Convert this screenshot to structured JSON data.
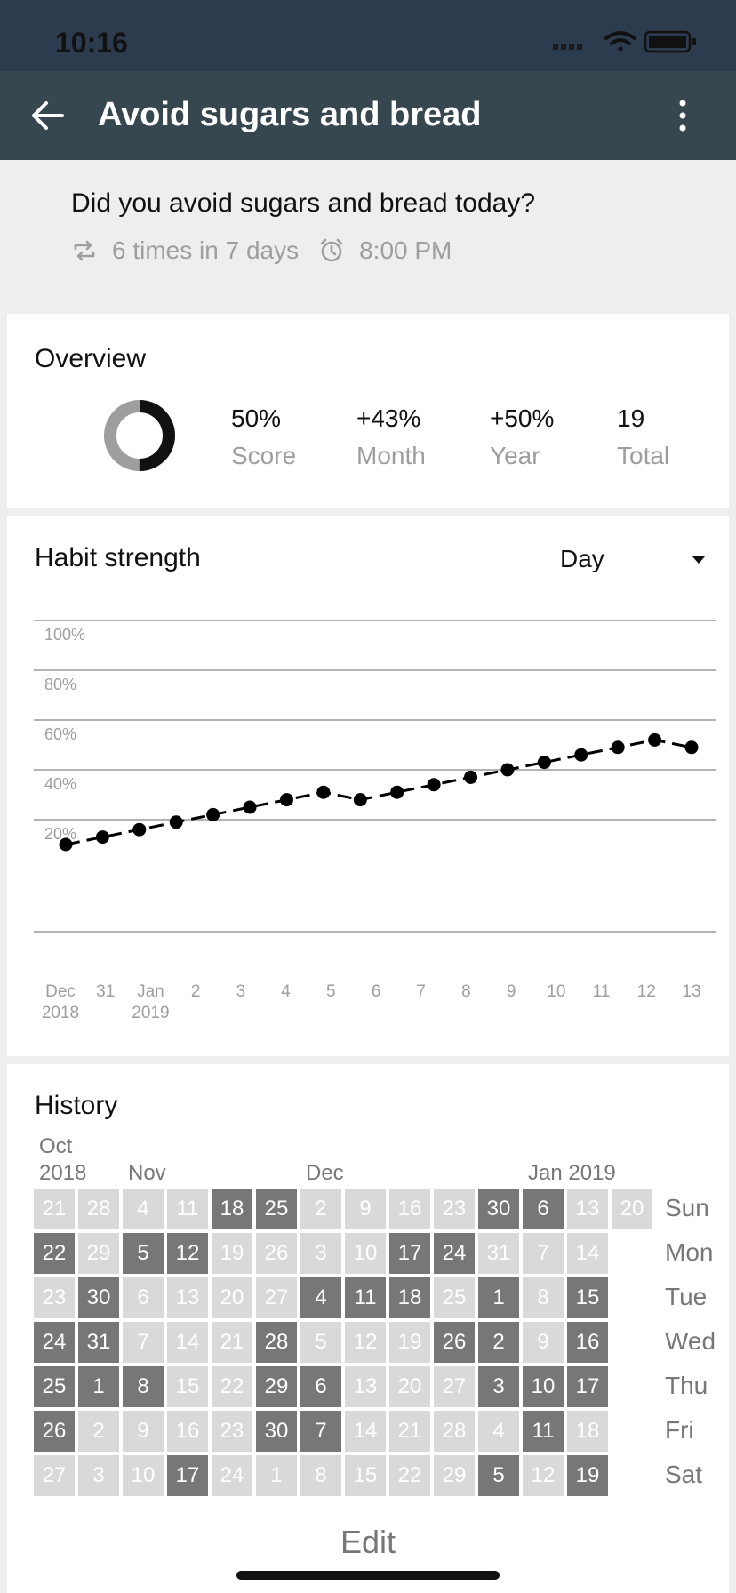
{
  "status_bar": {
    "time": "10:16"
  },
  "app_bar": {
    "title": "Avoid sugars and bread"
  },
  "header": {
    "question": "Did you avoid sugars and bread today?",
    "frequency": "6 times in 7 days",
    "reminder": "8:00 PM"
  },
  "overview": {
    "title": "Overview",
    "score_fraction": 0.5,
    "stats": [
      {
        "value": "50%",
        "label": "Score"
      },
      {
        "value": "+43%",
        "label": "Month"
      },
      {
        "value": "+50%",
        "label": "Year"
      },
      {
        "value": "19",
        "label": "Total"
      }
    ]
  },
  "strength": {
    "title": "Habit strength",
    "period": "Day",
    "chart_data": {
      "type": "line",
      "x": [
        "Dec 2018",
        "31",
        "Jan 2019",
        "2",
        "3",
        "4",
        "5",
        "6",
        "7",
        "8",
        "9",
        "10",
        "11",
        "12",
        "13"
      ],
      "x_ticks": [
        "Dec",
        "31",
        "Jan",
        "2",
        "3",
        "4",
        "5",
        "6",
        "7",
        "8",
        "9",
        "10",
        "11",
        "12",
        "13"
      ],
      "x_ticks_secondary": [
        "2018",
        "",
        "2019",
        "",
        "",
        "",
        "",
        "",
        "",
        "",
        "",
        "",
        "",
        "",
        ""
      ],
      "y_ticks": [
        "100%",
        "80%",
        "60%",
        "40%",
        "20%"
      ],
      "ylim": [
        0,
        100
      ],
      "grid": true,
      "series": [
        {
          "values": [
            10,
            13,
            16,
            19,
            22,
            25,
            28,
            31,
            28,
            31,
            34,
            37,
            40,
            43,
            46,
            49,
            52,
            49
          ]
        }
      ]
    }
  },
  "history": {
    "title": "History",
    "months": [
      {
        "line1": "Oct",
        "line2": "2018",
        "col": 0
      },
      {
        "line1": "",
        "line2": "Nov",
        "col": 2
      },
      {
        "line1": "",
        "line2": "Dec",
        "col": 6
      },
      {
        "line1": "",
        "line2": "Jan 2019",
        "col": 11
      }
    ],
    "weekdays": [
      "Sun",
      "Mon",
      "Tue",
      "Wed",
      "Thu",
      "Fri",
      "Sat"
    ],
    "weeks": [
      [
        [
          "21",
          0
        ],
        [
          "22",
          1
        ],
        [
          "23",
          0
        ],
        [
          "24",
          1
        ],
        [
          "25",
          1
        ],
        [
          "26",
          1
        ],
        [
          "27",
          0
        ]
      ],
      [
        [
          "28",
          0
        ],
        [
          "29",
          0
        ],
        [
          "30",
          1
        ],
        [
          "31",
          1
        ],
        [
          "1",
          1
        ],
        [
          "2",
          0
        ],
        [
          "3",
          0
        ]
      ],
      [
        [
          "4",
          0
        ],
        [
          "5",
          1
        ],
        [
          "6",
          0
        ],
        [
          "7",
          0
        ],
        [
          "8",
          1
        ],
        [
          "9",
          0
        ],
        [
          "10",
          0
        ]
      ],
      [
        [
          "11",
          0
        ],
        [
          "12",
          1
        ],
        [
          "13",
          0
        ],
        [
          "14",
          0
        ],
        [
          "15",
          0
        ],
        [
          "16",
          0
        ],
        [
          "17",
          1
        ]
      ],
      [
        [
          "18",
          1
        ],
        [
          "19",
          0
        ],
        [
          "20",
          0
        ],
        [
          "21",
          0
        ],
        [
          "22",
          0
        ],
        [
          "23",
          0
        ],
        [
          "24",
          0
        ]
      ],
      [
        [
          "25",
          1
        ],
        [
          "26",
          0
        ],
        [
          "27",
          0
        ],
        [
          "28",
          1
        ],
        [
          "29",
          1
        ],
        [
          "30",
          1
        ],
        [
          "1",
          0
        ]
      ],
      [
        [
          "2",
          0
        ],
        [
          "3",
          0
        ],
        [
          "4",
          1
        ],
        [
          "5",
          0
        ],
        [
          "6",
          1
        ],
        [
          "7",
          1
        ],
        [
          "8",
          0
        ]
      ],
      [
        [
          "9",
          0
        ],
        [
          "10",
          0
        ],
        [
          "11",
          1
        ],
        [
          "12",
          0
        ],
        [
          "13",
          0
        ],
        [
          "14",
          0
        ],
        [
          "15",
          0
        ]
      ],
      [
        [
          "16",
          0
        ],
        [
          "17",
          1
        ],
        [
          "18",
          1
        ],
        [
          "19",
          0
        ],
        [
          "20",
          0
        ],
        [
          "21",
          0
        ],
        [
          "22",
          0
        ]
      ],
      [
        [
          "23",
          0
        ],
        [
          "24",
          1
        ],
        [
          "25",
          0
        ],
        [
          "26",
          1
        ],
        [
          "27",
          0
        ],
        [
          "28",
          0
        ],
        [
          "29",
          0
        ]
      ],
      [
        [
          "30",
          1
        ],
        [
          "31",
          0
        ],
        [
          "1",
          1
        ],
        [
          "2",
          1
        ],
        [
          "3",
          1
        ],
        [
          "4",
          0
        ],
        [
          "5",
          1
        ]
      ],
      [
        [
          "6",
          1
        ],
        [
          "7",
          0
        ],
        [
          "8",
          0
        ],
        [
          "9",
          0
        ],
        [
          "10",
          1
        ],
        [
          "11",
          1
        ],
        [
          "12",
          0
        ]
      ],
      [
        [
          "13",
          0
        ],
        [
          "14",
          0
        ],
        [
          "15",
          1
        ],
        [
          "16",
          1
        ],
        [
          "17",
          1
        ],
        [
          "18",
          0
        ],
        [
          "19",
          1
        ]
      ],
      [
        [
          "20",
          0
        ]
      ]
    ],
    "edit_label": "Edit"
  }
}
